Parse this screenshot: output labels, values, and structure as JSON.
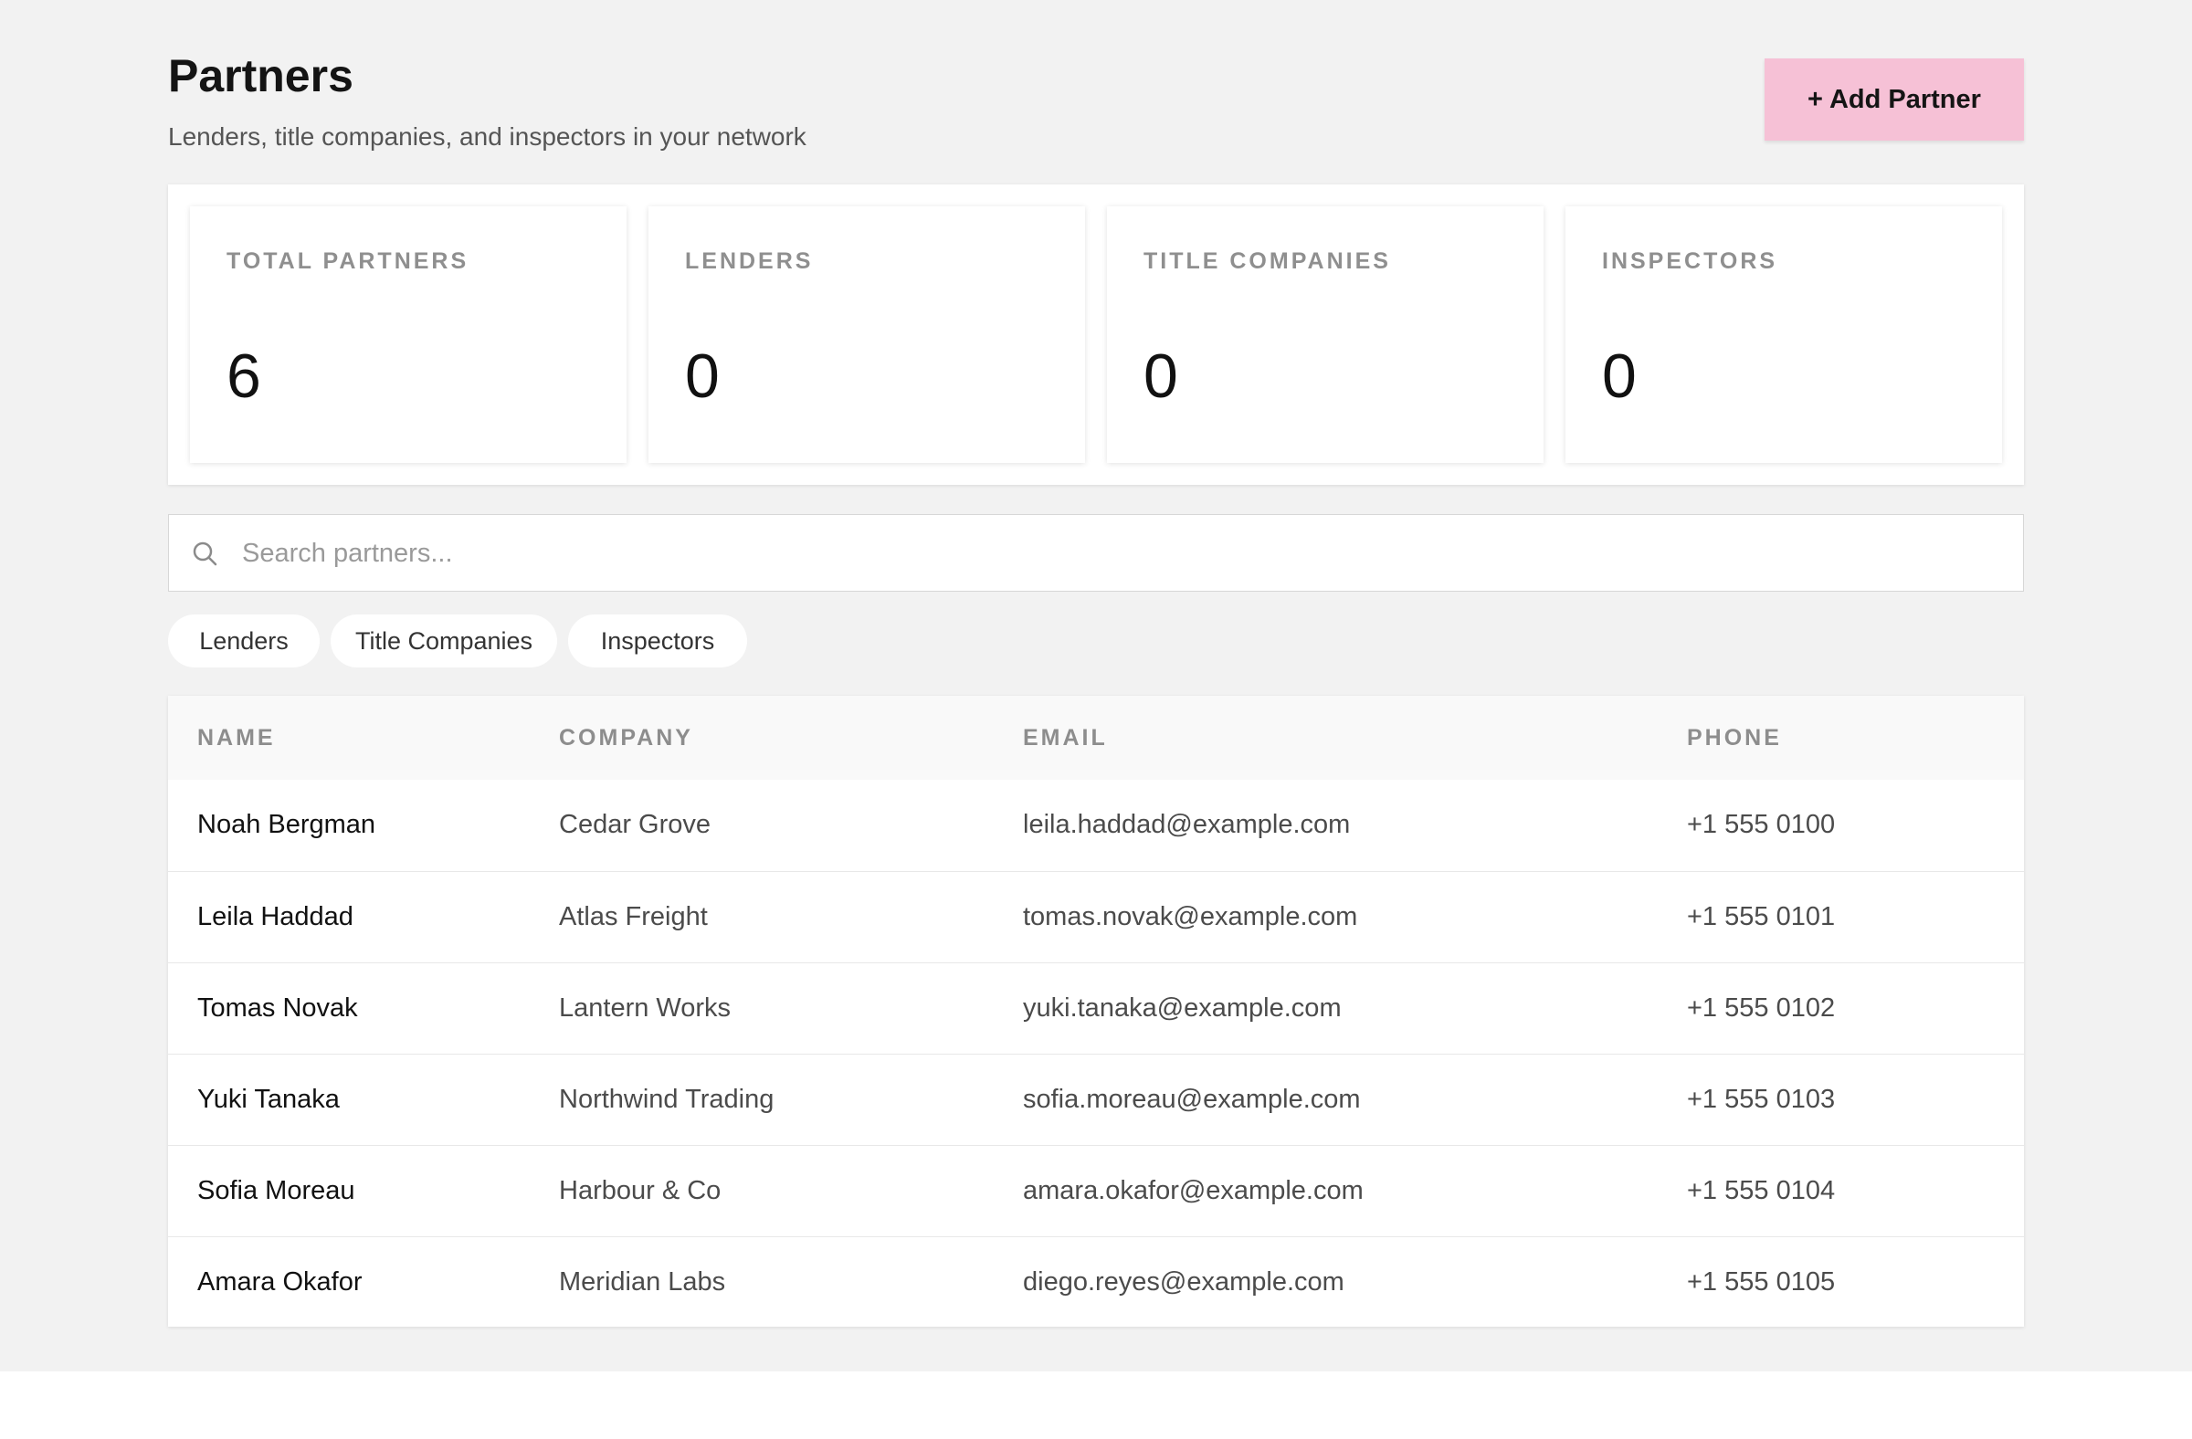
{
  "header": {
    "title": "Partners",
    "subtitle": "Lenders, title companies, and inspectors in your network",
    "add_button_label": "+ Add Partner"
  },
  "stats": [
    {
      "label": "TOTAL PARTNERS",
      "value": "6"
    },
    {
      "label": "LENDERS",
      "value": "0"
    },
    {
      "label": "TITLE COMPANIES",
      "value": "0"
    },
    {
      "label": "INSPECTORS",
      "value": "0"
    }
  ],
  "search": {
    "placeholder": "Search partners...",
    "icon": "search-icon"
  },
  "filters": [
    {
      "label": "Lenders"
    },
    {
      "label": "Title Companies"
    },
    {
      "label": "Inspectors"
    }
  ],
  "table": {
    "columns": [
      "NAME",
      "COMPANY",
      "EMAIL",
      "PHONE"
    ],
    "rows": [
      {
        "name": "Noah Bergman",
        "company": "Cedar Grove",
        "email": "leila.haddad@example.com",
        "phone": "+1 555 0100"
      },
      {
        "name": "Leila Haddad",
        "company": "Atlas Freight",
        "email": "tomas.novak@example.com",
        "phone": "+1 555 0101"
      },
      {
        "name": "Tomas Novak",
        "company": "Lantern Works",
        "email": "yuki.tanaka@example.com",
        "phone": "+1 555 0102"
      },
      {
        "name": "Yuki Tanaka",
        "company": "Northwind Trading",
        "email": "sofia.moreau@example.com",
        "phone": "+1 555 0103"
      },
      {
        "name": "Sofia Moreau",
        "company": "Harbour & Co",
        "email": "amara.okafor@example.com",
        "phone": "+1 555 0104"
      },
      {
        "name": "Amara Okafor",
        "company": "Meridian Labs",
        "email": "diego.reyes@example.com",
        "phone": "+1 555 0105"
      }
    ]
  },
  "colors": {
    "background": "#f2f2f2",
    "accent_button": "#f6c1d6",
    "surface": "#ffffff",
    "muted_text": "#8f8f8f"
  }
}
